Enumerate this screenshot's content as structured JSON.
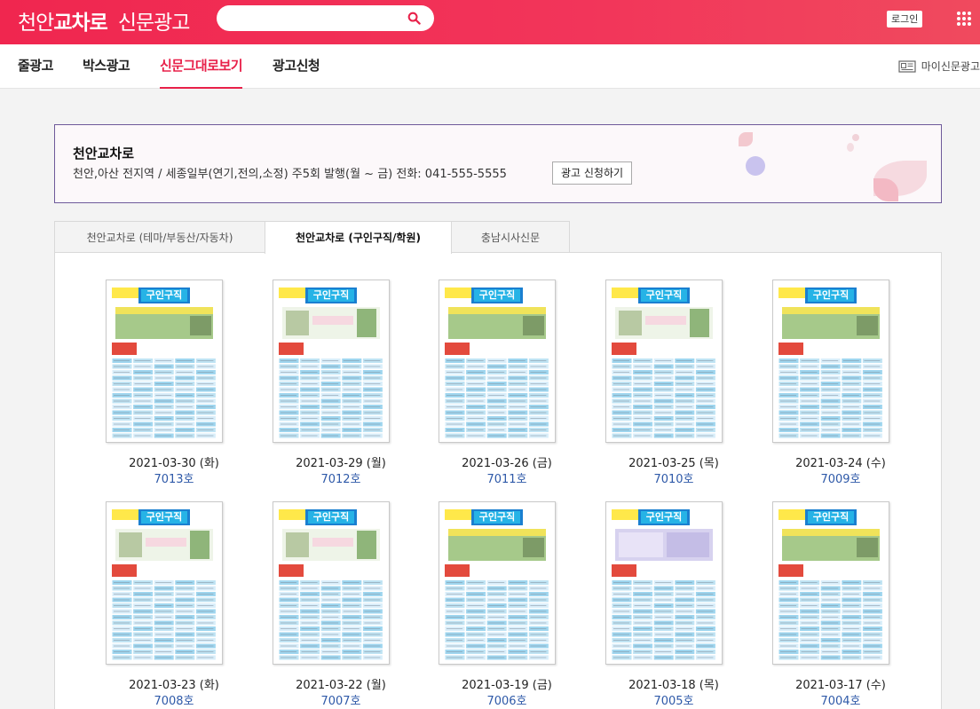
{
  "header": {
    "logo_city": "천안",
    "logo_brand": "교차로",
    "logo_suffix": "신문광고",
    "search_placeholder": "",
    "login_label": "로그인"
  },
  "nav": {
    "items": [
      {
        "label": "줄광고",
        "active": false
      },
      {
        "label": "박스광고",
        "active": false
      },
      {
        "label": "신문그대로보기",
        "active": true
      },
      {
        "label": "광고신청",
        "active": false
      }
    ],
    "my_ad_label": "마이신문광고"
  },
  "info": {
    "title": "천안교차로",
    "description": "천안,아산 전지역 / 세종일부(연기,전의,소정) 주5회 발행(월 ~ 금) 전화: 041-555-5555",
    "apply_button": "광고 신청하기"
  },
  "tabs": [
    {
      "label": "천안교차로 (테마/부동산/자동차)",
      "active": false
    },
    {
      "label": "천안교차로 (구인구직/학원)",
      "active": true
    },
    {
      "label": "충남시사신문",
      "active": false
    }
  ],
  "issues": [
    {
      "date": "2021-03-30 (화)",
      "number": "7013호",
      "headline": "구인구직",
      "variant": "a"
    },
    {
      "date": "2021-03-29 (월)",
      "number": "7012호",
      "headline": "구인구직",
      "variant": "b"
    },
    {
      "date": "2021-03-26 (금)",
      "number": "7011호",
      "headline": "구인구직",
      "variant": "a"
    },
    {
      "date": "2021-03-25 (목)",
      "number": "7010호",
      "headline": "구인구직",
      "variant": "b"
    },
    {
      "date": "2021-03-24 (수)",
      "number": "7009호",
      "headline": "구인구직",
      "variant": "a"
    },
    {
      "date": "2021-03-23 (화)",
      "number": "7008호",
      "headline": "구인구직",
      "variant": "b"
    },
    {
      "date": "2021-03-22 (월)",
      "number": "7007호",
      "headline": "구인구직",
      "variant": "b"
    },
    {
      "date": "2021-03-19 (금)",
      "number": "7006호",
      "headline": "구인구직",
      "variant": "a"
    },
    {
      "date": "2021-03-18 (목)",
      "number": "7005호",
      "headline": "구인구직",
      "variant": "c"
    },
    {
      "date": "2021-03-17 (수)",
      "number": "7004호",
      "headline": "구인구직",
      "variant": "a"
    }
  ],
  "colors": {
    "brand": "#f0264f",
    "active_nav": "#e8214a",
    "link": "#2e59a8",
    "info_border": "#6e5a9a"
  }
}
